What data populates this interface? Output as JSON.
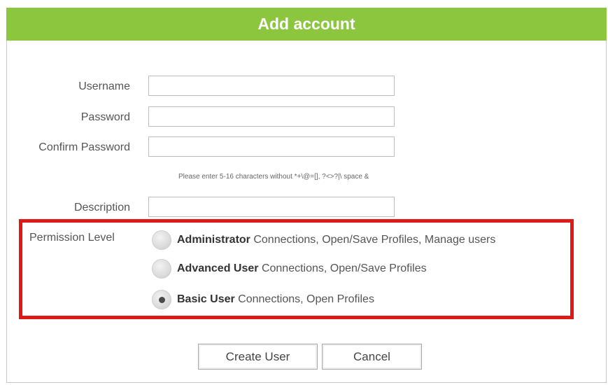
{
  "dialog": {
    "title": "Add account"
  },
  "form": {
    "username": {
      "label": "Username",
      "value": ""
    },
    "password": {
      "label": "Password",
      "value": ""
    },
    "confirm_password": {
      "label": "Confirm Password",
      "value": ""
    },
    "hint": "Please enter 5-16 characters without *+\\@=[],  ?<>?|\\ space &",
    "description": {
      "label": "Description",
      "value": ""
    }
  },
  "permission": {
    "label": "Permission Level",
    "options": [
      {
        "title": "Administrator",
        "desc": " Connections, Open/Save Profiles, Manage users",
        "checked": false
      },
      {
        "title": "Advanced User",
        "desc": " Connections, Open/Save Profiles",
        "checked": false
      },
      {
        "title": "Basic User",
        "desc": " Connections, Open Profiles",
        "checked": true
      }
    ]
  },
  "buttons": {
    "create": "Create User",
    "cancel": "Cancel"
  },
  "colors": {
    "title_bar": "#8cc63f",
    "highlight": "#e01818"
  }
}
